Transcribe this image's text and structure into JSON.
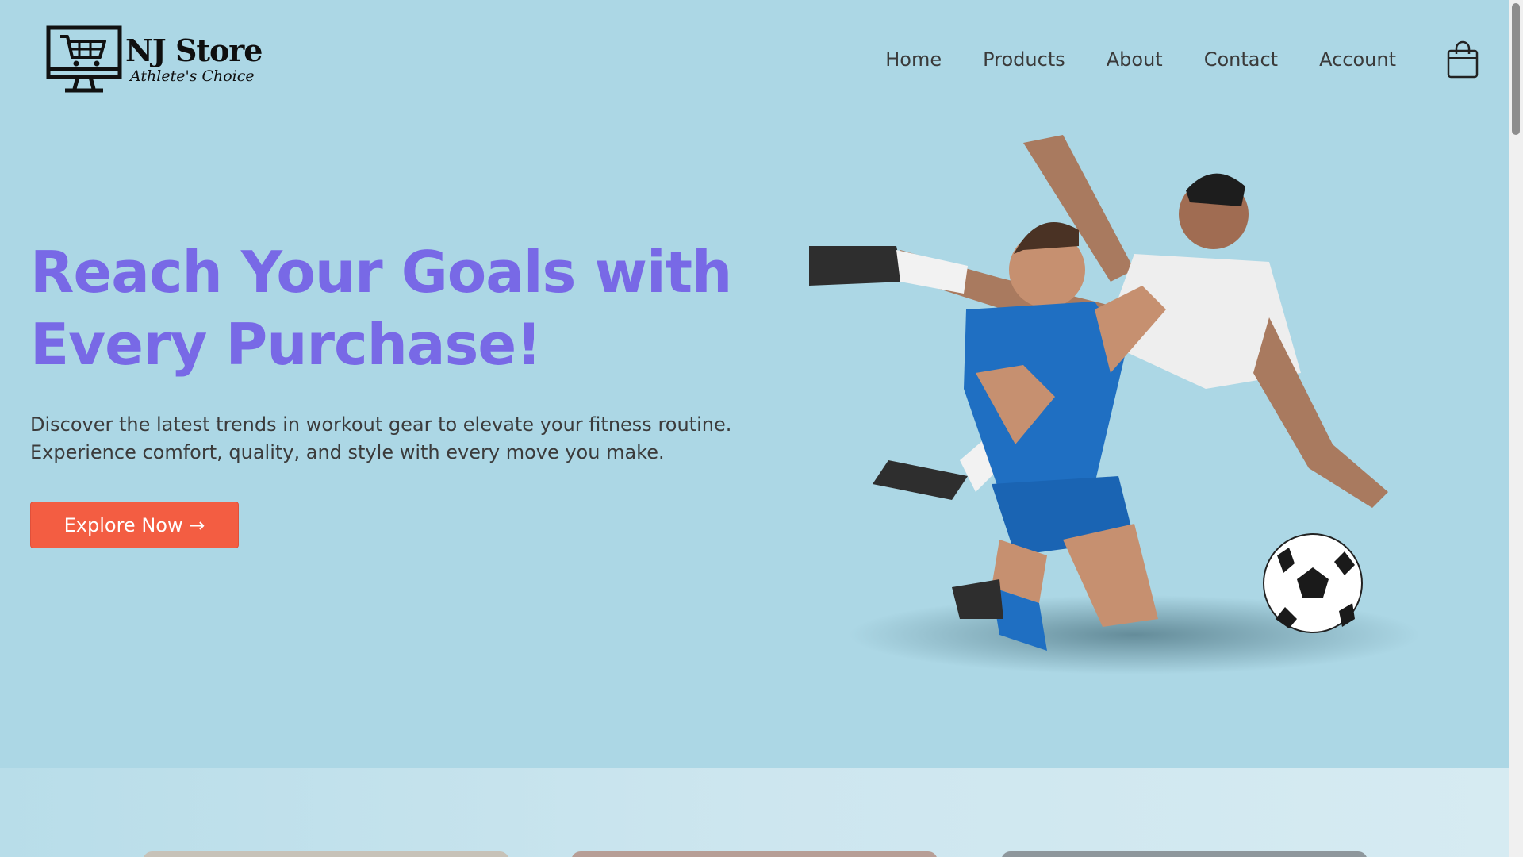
{
  "brand": {
    "name": "NJ Store",
    "tagline": "Athlete's Choice",
    "logo_icon": "shopping-cart-monitor-icon"
  },
  "nav": {
    "items": [
      "Home",
      "Products",
      "About",
      "Contact",
      "Account"
    ],
    "cart_icon": "shopping-bag-icon"
  },
  "hero": {
    "title_line1": "Reach Your Goals with",
    "title_line2": "Every Purchase!",
    "desc_line1": "Discover the latest trends in workout gear to elevate your fitness routine.",
    "desc_line2": "Experience comfort, quality, and style with every move you make.",
    "cta_label": "Explore Now →",
    "image": "two-soccer-players-celebrating-with-ball"
  },
  "colors": {
    "background": "#acd7e5",
    "title": "#7869e6",
    "cta": "#f35d42",
    "text": "#3b3b3b"
  }
}
